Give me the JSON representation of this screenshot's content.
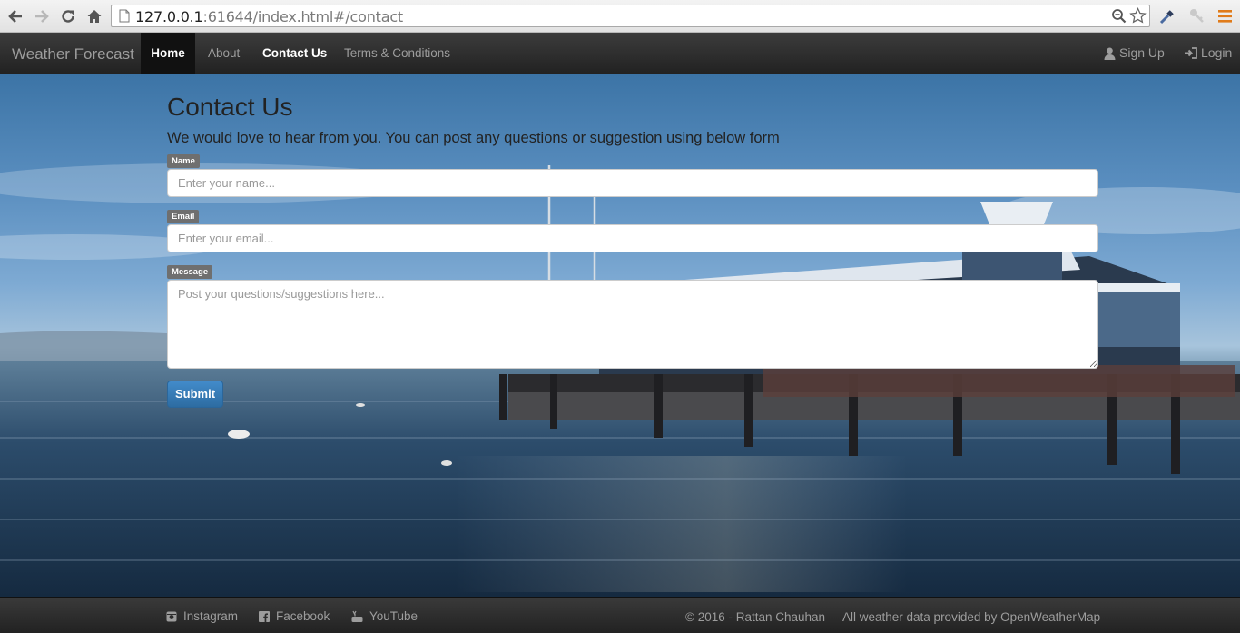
{
  "browser": {
    "url_host": "127.0.0.1",
    "url_rest": ":61644/index.html#/contact"
  },
  "navbar": {
    "brand": "Weather Forecast",
    "items": [
      {
        "label": "Home"
      },
      {
        "label": "About"
      },
      {
        "label": "Contact Us"
      },
      {
        "label": "Terms & Conditions"
      }
    ],
    "sign_up": "Sign Up",
    "login": "Login"
  },
  "contact": {
    "title": "Contact Us",
    "lead": "We would love to hear from you. You can post any questions or suggestion using below form",
    "name_label": "Name",
    "name_placeholder": "Enter your name...",
    "email_label": "Email",
    "email_placeholder": "Enter your email...",
    "message_label": "Message",
    "message_placeholder": "Post your questions/suggestions here...",
    "submit_label": "Submit"
  },
  "footer": {
    "instagram": "Instagram",
    "facebook": "Facebook",
    "youtube": "YouTube",
    "copyright": "© 2016 - Rattan Chauhan",
    "credit": "All weather data provided by OpenWeatherMap"
  },
  "colors": {
    "navbar_bg": "#222222",
    "accent_button": "#428bca",
    "label_bg": "#6f6f6f"
  }
}
